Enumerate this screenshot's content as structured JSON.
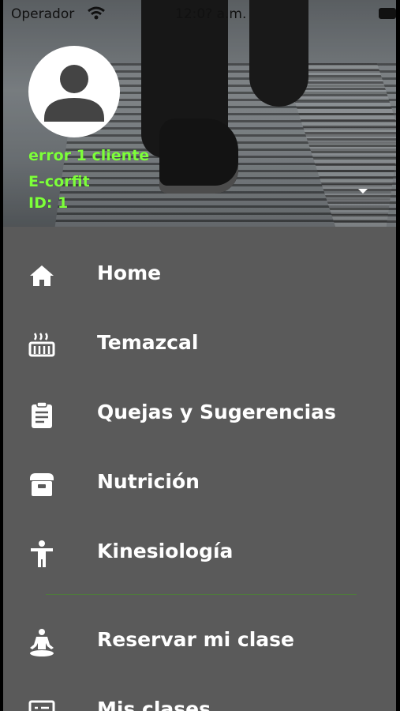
{
  "status_bar": {
    "carrier": "Operador",
    "time": "12:0? a.m."
  },
  "profile": {
    "name": "error 1 cliente",
    "brand": "E-corfit",
    "id": "ID: 1"
  },
  "menu": {
    "items": [
      {
        "label": "Home",
        "icon": "home-icon"
      },
      {
        "label": "Temazcal",
        "icon": "temazcal-icon"
      },
      {
        "label": "Quejas y Sugerencias",
        "icon": "clipboard-icon"
      },
      {
        "label": "Nutrición",
        "icon": "food-icon"
      },
      {
        "label": "Kinesiología",
        "icon": "accessibility-icon"
      },
      {
        "label": "Reservar mi clase",
        "icon": "meditation-icon"
      },
      {
        "label": "Mis clases",
        "icon": "list-icon"
      }
    ]
  },
  "colors": {
    "menu_bg": "#5a5a5a",
    "profile_text": "#7dff3a",
    "divider": "#4f7a3d"
  }
}
